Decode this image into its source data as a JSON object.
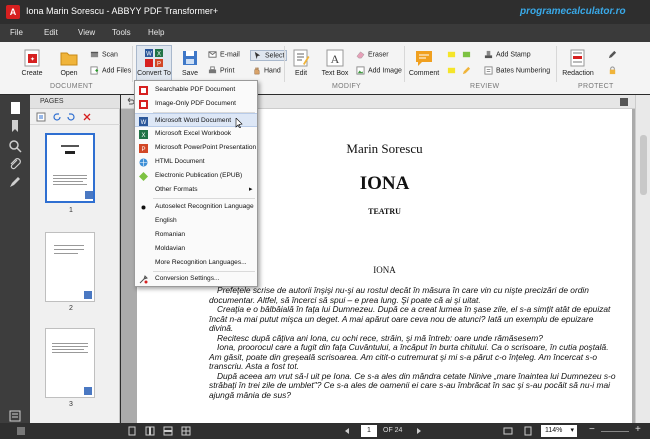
{
  "window": {
    "title": "Iona Marin Sorescu - ABBYY PDF Transformer+",
    "watermark": "programecalculator.ro"
  },
  "menu": [
    "File",
    "Edit",
    "View",
    "Tools",
    "Help"
  ],
  "ribbon": {
    "create": "Create",
    "open": "Open",
    "scan": "Scan",
    "add_files": "Add Files",
    "convert_to": "Convert To",
    "save": "Save",
    "email": "E-mail",
    "print": "Print",
    "select": "Select",
    "hand": "Hand",
    "edit": "Edit",
    "text_box": "Text Box",
    "eraser": "Eraser",
    "add_image": "Add Image",
    "comment": "Comment",
    "add_stamp": "Add Stamp",
    "bates_numbering": "Bates Numbering",
    "redaction": "Redaction"
  },
  "groups": [
    "DOCUMENT",
    "MODIFY",
    "REVIEW",
    "PROTECT"
  ],
  "pages_pane": {
    "header": "PAGES",
    "thumbs": [
      "1",
      "2",
      "3"
    ]
  },
  "dropdown": {
    "items": [
      {
        "label": "Searchable PDF Document",
        "icon": "pdf-icon"
      },
      {
        "label": "Image-Only PDF Document",
        "icon": "pdf-icon"
      },
      {
        "label": "Microsoft Word Document",
        "icon": "word-icon"
      },
      {
        "label": "Microsoft Excel Workbook",
        "icon": "excel-icon"
      },
      {
        "label": "Microsoft PowerPoint Presentation",
        "icon": "powerpoint-icon"
      },
      {
        "label": "HTML Document",
        "icon": "html-icon"
      },
      {
        "label": "Electronic Publication (EPUB)",
        "icon": "epub-icon"
      },
      {
        "label": "Other Formats",
        "icon": ""
      },
      {
        "label": "Autoselect Recognition Language",
        "icon": "bullet-icon"
      },
      {
        "label": "English",
        "icon": ""
      },
      {
        "label": "Romanian",
        "icon": ""
      },
      {
        "label": "Moldavian",
        "icon": ""
      },
      {
        "label": "More Recognition Languages...",
        "icon": ""
      },
      {
        "label": "Conversion Settings...",
        "icon": "settings-icon"
      }
    ]
  },
  "document": {
    "author": "Marin Sorescu",
    "title": "IONA",
    "subtitle": "TEATRU",
    "heading": "IONA",
    "paragraphs": [
      "Prefeţele scrise de autorii înşişi nu-şi au rostul decât în măsura în care vin cu nişte precizări de ordin documentar. Altfel, să încerci să spui – e prea lung. Şi poate că ai şi uitat.",
      "Creaţia e o bâlbâială în faţa lui Dumnezeu. După ce a creat lumea în şase zile, el s-a simţit atât de epuizat încât n-a mai putut mişca un deget. A mai apărut oare ceva nou de atunci? Iată un exemplu de epuizare divină.",
      "Recitesc după câţiva ani Iona, cu ochi rece, străin, şi mă întreb: oare unde rămăsesem?",
      "Iona, proorocul care a fugit din faţa Cuvântului, a încăput în burta chitului. Ca o scrisoare, în cutia poştală. Am găsit, poate din greşeală scrisoarea. Am citit-o cutremurat şi mi s-a părut c-o înţeleg. Am încercat s-o transcriu. Asta a fost tot.",
      "După aceea am vrut să-l uit pe Iona. Ce s-a ales din mândra cetate Ninive „mare înaintea lui Dumnezeu s-o străbaţi în trei zile de umblet\"? Ce s-a ales de oamenii ei care s-au îmbrăcat în sac şi s-au pocăit să nu-i mai ajungă mânia de sus?"
    ]
  },
  "status": {
    "page_current": "1",
    "page_total": "OF 24",
    "zoom": "114%"
  }
}
